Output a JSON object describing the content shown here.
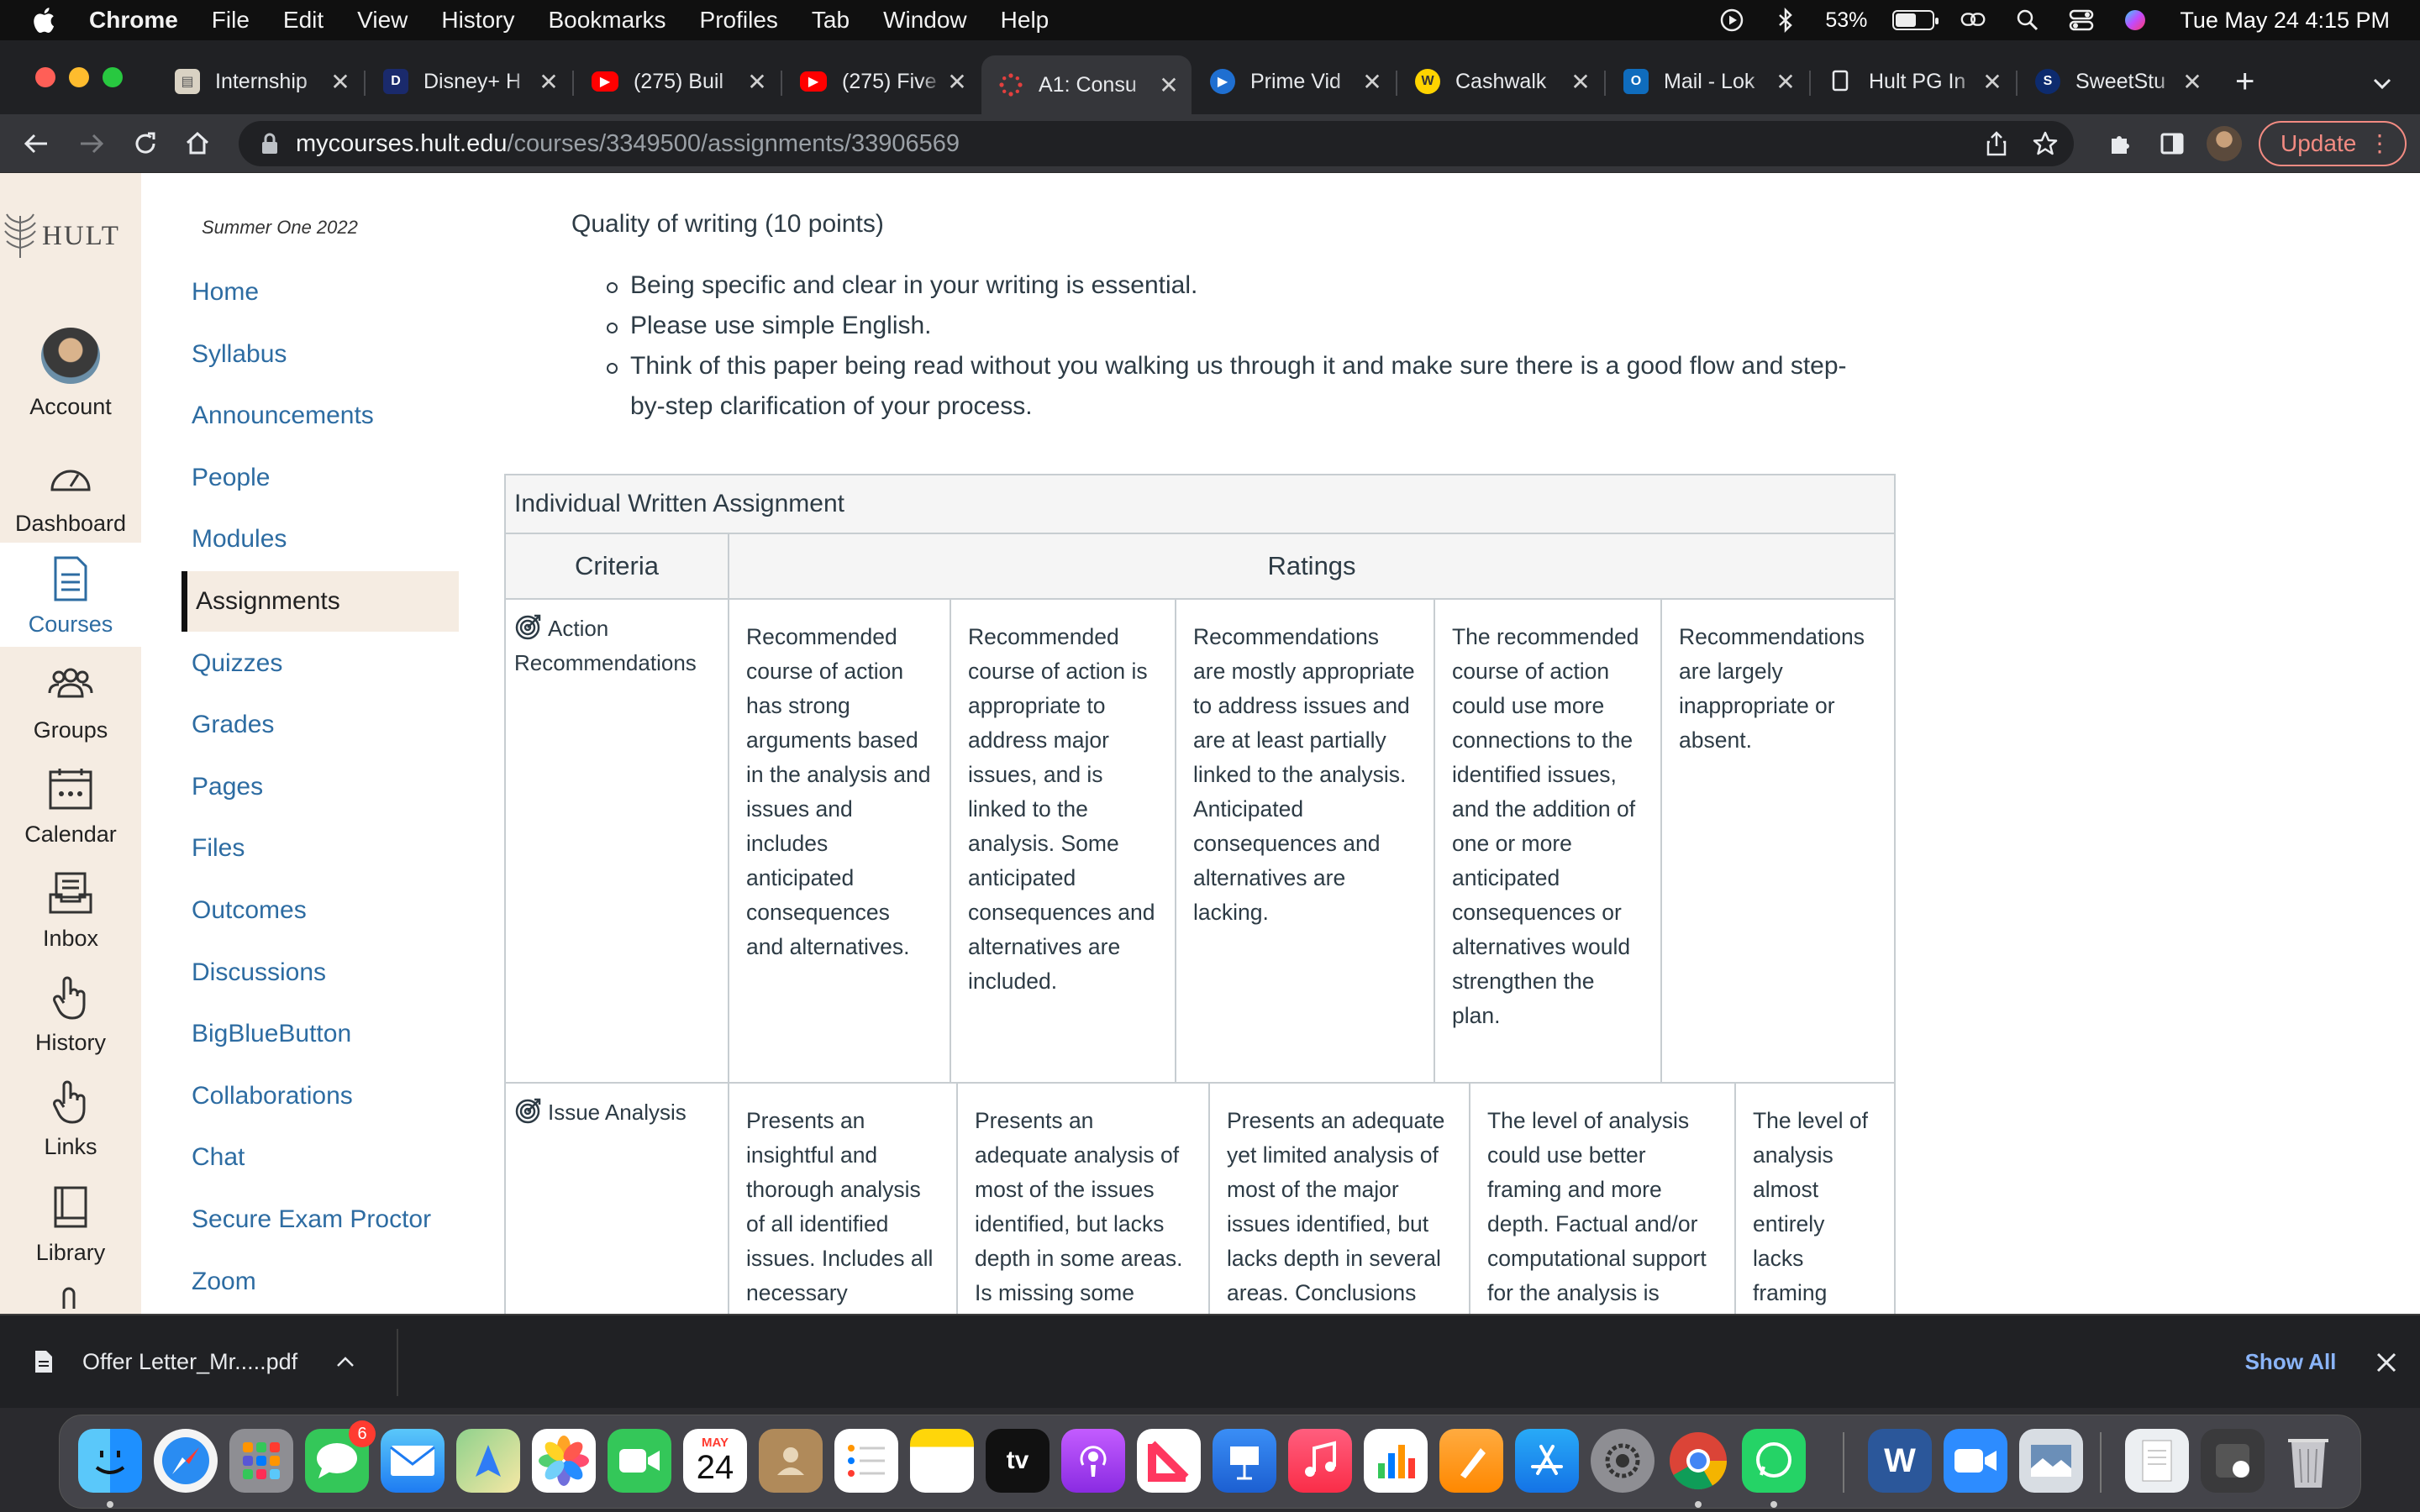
{
  "menubar": {
    "items": [
      "Chrome",
      "File",
      "Edit",
      "View",
      "History",
      "Bookmarks",
      "Profiles",
      "Tab",
      "Window",
      "Help"
    ],
    "battery": "53%",
    "clock": "Tue May 24  4:15 PM"
  },
  "tabs": [
    {
      "title": "Internship",
      "favicon": "document-icon"
    },
    {
      "title": "Disney+ H",
      "favicon": "disney-icon"
    },
    {
      "title": "(275) Buil",
      "favicon": "youtube-icon"
    },
    {
      "title": "(275) Five",
      "favicon": "youtube-icon"
    },
    {
      "title": "A1: Consu",
      "favicon": "canvas-icon",
      "active": true
    },
    {
      "title": "Prime Vid",
      "favicon": "prime-video-icon"
    },
    {
      "title": "Cashwalk",
      "favicon": "cashwalk-icon"
    },
    {
      "title": "Mail - Lok",
      "favicon": "outlook-icon"
    },
    {
      "title": "Hult PG In",
      "favicon": "page-icon"
    },
    {
      "title": "SweetStu",
      "favicon": "sweetstudy-icon"
    }
  ],
  "address": {
    "host": "mycourses.hult.edu",
    "path": "/courses/3349500/assignments/33906569"
  },
  "toolbar": {
    "update_label": "Update"
  },
  "global_nav": {
    "logo_text": "HULT",
    "items": [
      "Account",
      "Dashboard",
      "Courses",
      "Groups",
      "Calendar",
      "Inbox",
      "History",
      "Links",
      "Library"
    ]
  },
  "course_nav": {
    "term": "Summer One 2022",
    "items": [
      "Home",
      "Syllabus",
      "Announcements",
      "People",
      "Modules",
      "Assignments",
      "Quizzes",
      "Grades",
      "Pages",
      "Files",
      "Outcomes",
      "Discussions",
      "BigBlueButton",
      "Collaborations",
      "Chat",
      "Secure Exam Proctor",
      "Zoom"
    ],
    "active": "Assignments"
  },
  "content": {
    "quality_title": "Quality of writing (10 points)",
    "bullets": [
      "Being specific and clear in your writing is essential.",
      "Please use simple English.",
      "Think of this paper being read without you walking us through it and make sure there is a good flow and step-by-step clarification of your process."
    ]
  },
  "rubric": {
    "title": "Individual Written Assignment",
    "col_criteria": "Criteria",
    "col_ratings": "Ratings",
    "rows": [
      {
        "criterion": "Action Recommendations",
        "ratings": [
          "Recommended course of action has strong arguments based in the analysis and issues and includes anticipated consequences and alternatives.",
          "Recommended course of action is appropriate to address major issues, and is linked to the analysis. Some anticipated consequences and alternatives are included.",
          "Recommendations are mostly appropriate to address issues and are at least partially linked to the analysis. Anticipated consequences and alternatives are lacking.",
          "The recommended course of action could use more connections to the identified issues, and the addition of one or more anticipated consequences or alternatives would strengthen the plan.",
          "Recommendations are largely inappropriate or absent."
        ]
      },
      {
        "criterion": "Issue Analysis",
        "ratings": [
          "Presents an insightful and thorough analysis of all identified issues. Includes all necessary",
          "Presents an adequate analysis of most of the issues identified, but lacks depth in some areas. Is missing some",
          "Presents an adequate yet limited analysis of most of the major issues identified, but lacks depth in several areas. Conclusions",
          "The level of analysis could use better framing and more depth. Factual and/or computational support for the analysis is",
          "The level of analysis almost entirely lacks framing"
        ]
      }
    ]
  },
  "downloads": {
    "file": "Offer Letter_Mr.....pdf",
    "show_all": "Show All"
  },
  "dock": {
    "calendar_month": "MAY",
    "calendar_day": "24",
    "messages_badge": "6",
    "tv_label": "tv",
    "word_letter": "W"
  }
}
